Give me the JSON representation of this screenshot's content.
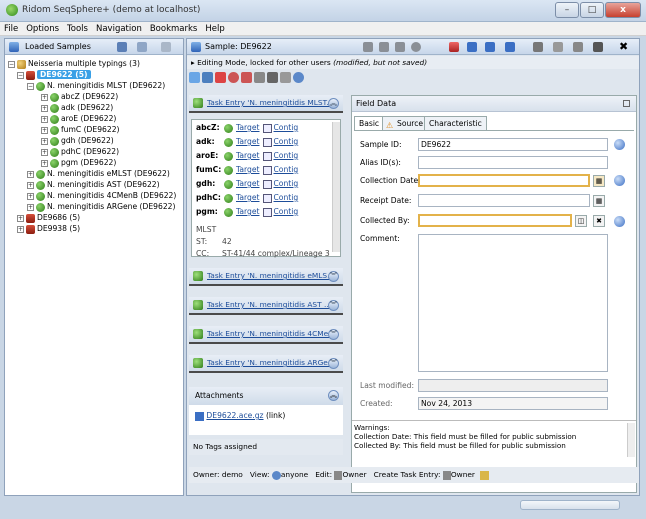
{
  "window": {
    "title": "Ridom SeqSphere+ (demo at localhost)",
    "minimize": "–",
    "maximize": "□",
    "close": "x"
  },
  "menu": {
    "file": "File",
    "options": "Options",
    "tools": "Tools",
    "navigation": "Navigation",
    "bookmarks": "Bookmarks",
    "help": "Help"
  },
  "left": {
    "header": "Loaded Samples",
    "tree": {
      "root": "Neisseria multiple typings (3)",
      "sample1": "DE9622 (5)",
      "mlst": "N. meningitidis MLST (DE9622)",
      "genes": [
        "abcZ (DE9622)",
        "adk (DE9622)",
        "aroE (DE9622)",
        "fumC (DE9622)",
        "gdh (DE9622)",
        "pdhC (DE9622)",
        "pgm (DE9622)"
      ],
      "emlst": "N. meningitidis eMLST (DE9622)",
      "ast": "N. meningitidis AST (DE9622)",
      "fourcmenb": "N. meningitidis 4CMenB (DE9622)",
      "argene": "N. meningitidis ARGene (DE9622)",
      "sample2": "DE9686 (5)",
      "sample3": "DE9938 (5)"
    }
  },
  "right": {
    "header": "Sample: DE9622",
    "editmode": "Editing Mode, locked for other users",
    "editmode_note": "(modified, but not saved)",
    "tasks": {
      "mlst": "Task Entry 'N. meningitidis MLST...",
      "emlst": "Task Entry 'N. meningitidis eMLS...",
      "ast": "Task Entry 'N. meningitidis AST ...",
      "fourcme": "Task Entry 'N. meningitidis 4CMe...",
      "arge": "Task Entry 'N. meningitidis ARGe..."
    },
    "mlst_rows": [
      {
        "locus": "abcZ:",
        "target": "Target",
        "contig": "Contig"
      },
      {
        "locus": "adk:",
        "target": "Target",
        "contig": "Contig"
      },
      {
        "locus": "aroE:",
        "target": "Target",
        "contig": "Contig"
      },
      {
        "locus": "fumC:",
        "target": "Target",
        "contig": "Contig"
      },
      {
        "locus": "gdh:",
        "target": "Target",
        "contig": "Contig"
      },
      {
        "locus": "pdhC:",
        "target": "Target",
        "contig": "Contig"
      },
      {
        "locus": "pgm:",
        "target": "Target",
        "contig": "Contig"
      }
    ],
    "mlst_summary": {
      "label": "MLST",
      "st_label": "ST:",
      "st": "42",
      "cc_label": "CC:",
      "cc": "ST-41/44 complex/Lineage 3"
    },
    "attachments": {
      "header": "Attachments",
      "file": "DE9622.ace.gz",
      "kind": "(link)"
    },
    "tags": "No Tags assigned",
    "field": {
      "header": "Field Data",
      "tabs": [
        "Basic",
        "Source",
        "Characteristic"
      ],
      "sample_id_label": "Sample ID:",
      "sample_id": "DE9622",
      "alias_label": "Alias ID(s):",
      "alias": "",
      "collection_date_label": "Collection Date:",
      "receipt_date_label": "Receipt Date:",
      "collected_by_label": "Collected By:",
      "comment_label": "Comment:",
      "last_modified_label": "Last modified:",
      "created_label": "Created:",
      "created": "Nov 24, 2013",
      "warnings_title": "Warnings:",
      "warning1": "Collection Date: This field must be filled for public submission",
      "warning2": "Collected By: This field must be filled for public submission"
    },
    "bottom": {
      "owner_label": "Owner: demo",
      "view_label": "View:",
      "view": "anyone",
      "edit_label": "Edit:",
      "edit": "Owner",
      "create_label": "Create Task Entry:",
      "create": "Owner"
    }
  }
}
